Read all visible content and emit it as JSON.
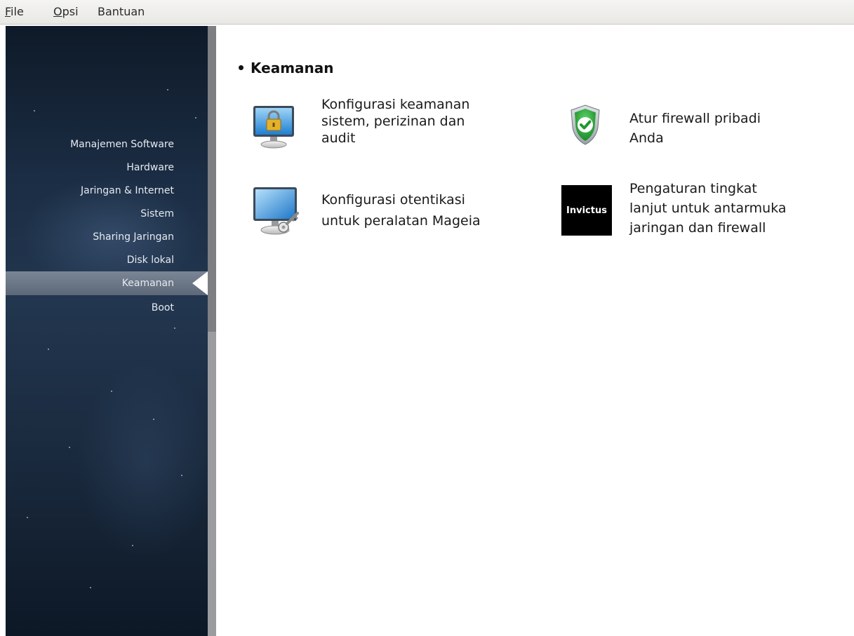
{
  "menu": {
    "file": {
      "mnemonic": "F",
      "rest": "ile"
    },
    "options": {
      "mnemonic": "O",
      "rest": "psi"
    },
    "help": "Bantuan"
  },
  "sidebar": {
    "items": [
      {
        "label": "Manajemen Software"
      },
      {
        "label": "Hardware"
      },
      {
        "label": "Jaringan & Internet"
      },
      {
        "label": "Sistem"
      },
      {
        "label": "Sharing Jaringan"
      },
      {
        "label": "Disk lokal"
      },
      {
        "label": "Keamanan",
        "active": true
      },
      {
        "label": "Boot"
      }
    ]
  },
  "main": {
    "section_title": "Keamanan",
    "items": [
      {
        "icon": "monitor-lock-icon",
        "lines": [
          "Konfigurasi keamanan",
          "sistem, perizinan dan",
          "audit"
        ]
      },
      {
        "icon": "shield-check-icon",
        "lines": [
          "Atur firewall pribadi",
          "Anda"
        ]
      },
      {
        "icon": "monitor-key-icon",
        "lines": [
          "Konfigurasi otentikasi",
          "untuk peralatan Mageia"
        ]
      },
      {
        "icon": "invictus-logo",
        "icon_text": "Invictus",
        "lines": [
          "Pengaturan tingkat",
          "lanjut untuk antarmuka",
          "jaringan dan firewall"
        ]
      }
    ]
  },
  "colors": {
    "sidebar_bg": "#1b2d44",
    "active_band": "#6c7787",
    "shield_green": "#2fae3c"
  }
}
